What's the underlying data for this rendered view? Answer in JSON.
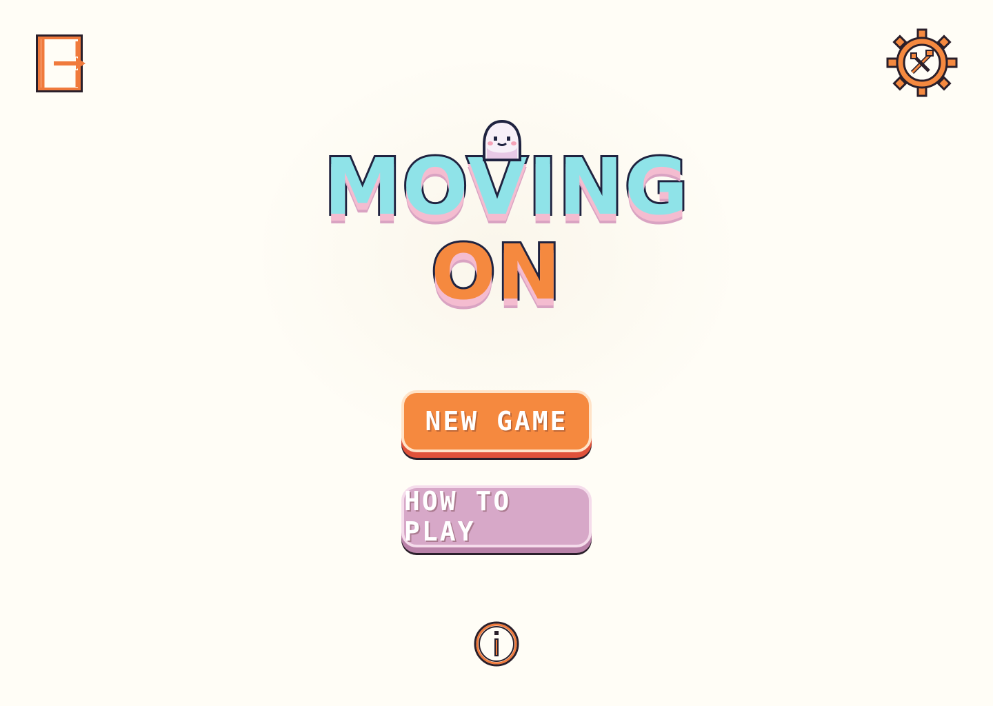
{
  "game": {
    "title_line_1": "MOVING",
    "title_line_2": "ON"
  },
  "menu": {
    "new_game_label": "NEW GAME",
    "how_to_play_label": "HOW TO PLAY"
  },
  "colors": {
    "background": "#fffdf6",
    "accent_orange": "#f5893f",
    "accent_pink": "#d7a8c8",
    "title_cyan": "#8fe3e8",
    "outline_dark": "#1f2340",
    "icon_stroke": "#f07a3c"
  },
  "icons": {
    "exit": "exit-door-icon",
    "settings": "settings-gear-icon",
    "info": "info-icon",
    "mascot": "ghost-mascot-icon"
  }
}
